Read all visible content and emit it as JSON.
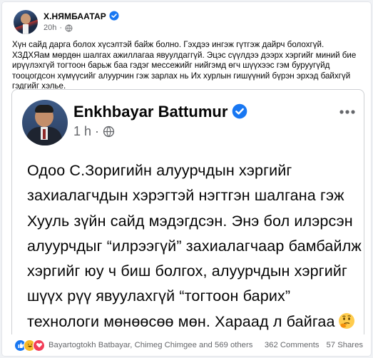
{
  "post": {
    "author": "Х.НЯМБААТАР",
    "time": "20h",
    "text": "Хүн сайд дарга болох хүсэлтэй байж болно. Гэхдээ ингэж гүтгэж дайрч болохгүй. ХЗДХЯам мөрдөн шалгах ажиллагаа явуулдаггүй. Эцэс сүүлдээ дээрх хэргийг миний биe ирүүлэхгүй тогтоон барьж бaa гэдэг мессежийг нийгэмд өгч шүүхээс гэм буруугүйд тооцогдсон хүмүүсийг алуурчин гэж зарлах нь Их хурлын гишүүний бүрэн эрхэд байхгүй гэдгийг хэлье."
  },
  "shared_post": {
    "author": "Enkhbayar Battumur",
    "time": "1 h",
    "separator": "·",
    "text": "Одоо С.Зоригийн алуурчдын хэргийг захиалагчдын хэрэгтэй нэгтгэн шалгана гэж Хууль зүйн сайд мэдэгдсэн. Энэ бол илэрсэн алуурчдыг “илрээгүй” захиалагчаар бамбайлж хэргийг юу ч биш болгох, алуурчдын хэргийг шүүх рүү явуулахгүй “тогтоон барих” технологи мөнөөсөө мөн. Хараад л байгаа"
  },
  "reactions": {
    "names": "Bayartogtokh Batbayar, Chimeg Chimgee and 569 others",
    "comments": "362 Comments",
    "shares": "57 Shares"
  },
  "icons": {
    "verified": "verified-badge-icon",
    "globe": "globe-icon",
    "more": "more-options-icon",
    "emoji": "thinking-face-emoji"
  },
  "colors": {
    "verified": "#1877f2",
    "muted_text": "#65676b",
    "like": "#1877f2",
    "haha": "#f7b928",
    "love": "#f33e58"
  }
}
